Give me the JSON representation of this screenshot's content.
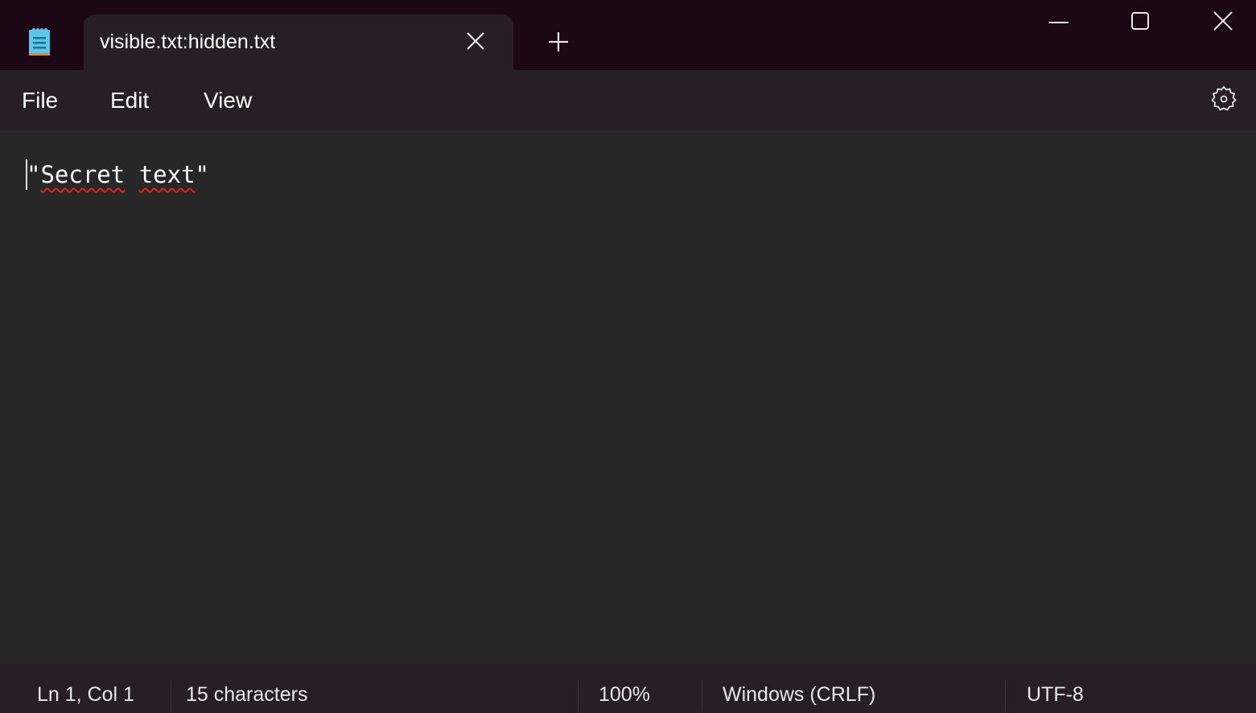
{
  "window": {
    "app_icon": "notepad-icon",
    "tab_title": "visible.txt:hidden.txt",
    "tab_close_icon": "close-icon",
    "new_tab_icon": "plus-icon",
    "controls": [
      "minimize-icon",
      "maximize-icon",
      "close-icon"
    ]
  },
  "menu": {
    "items": [
      "File",
      "Edit",
      "View"
    ],
    "settings_icon": "gear-icon"
  },
  "editor": {
    "content_prefix": "\"",
    "word1": "Secret",
    "space": " ",
    "word2": "text",
    "content_suffix": "\"",
    "misspelled": [
      "Secret",
      "text"
    ]
  },
  "status": {
    "position": "Ln 1, Col 1",
    "characters": "15 characters",
    "zoom": "100%",
    "line_ending": "Windows (CRLF)",
    "encoding": "UTF-8"
  },
  "colors": {
    "titlebar": "#1c0714",
    "tab_bg": "#281f26",
    "editor_bg": "#272727",
    "spellcheck": "#e0241e"
  }
}
